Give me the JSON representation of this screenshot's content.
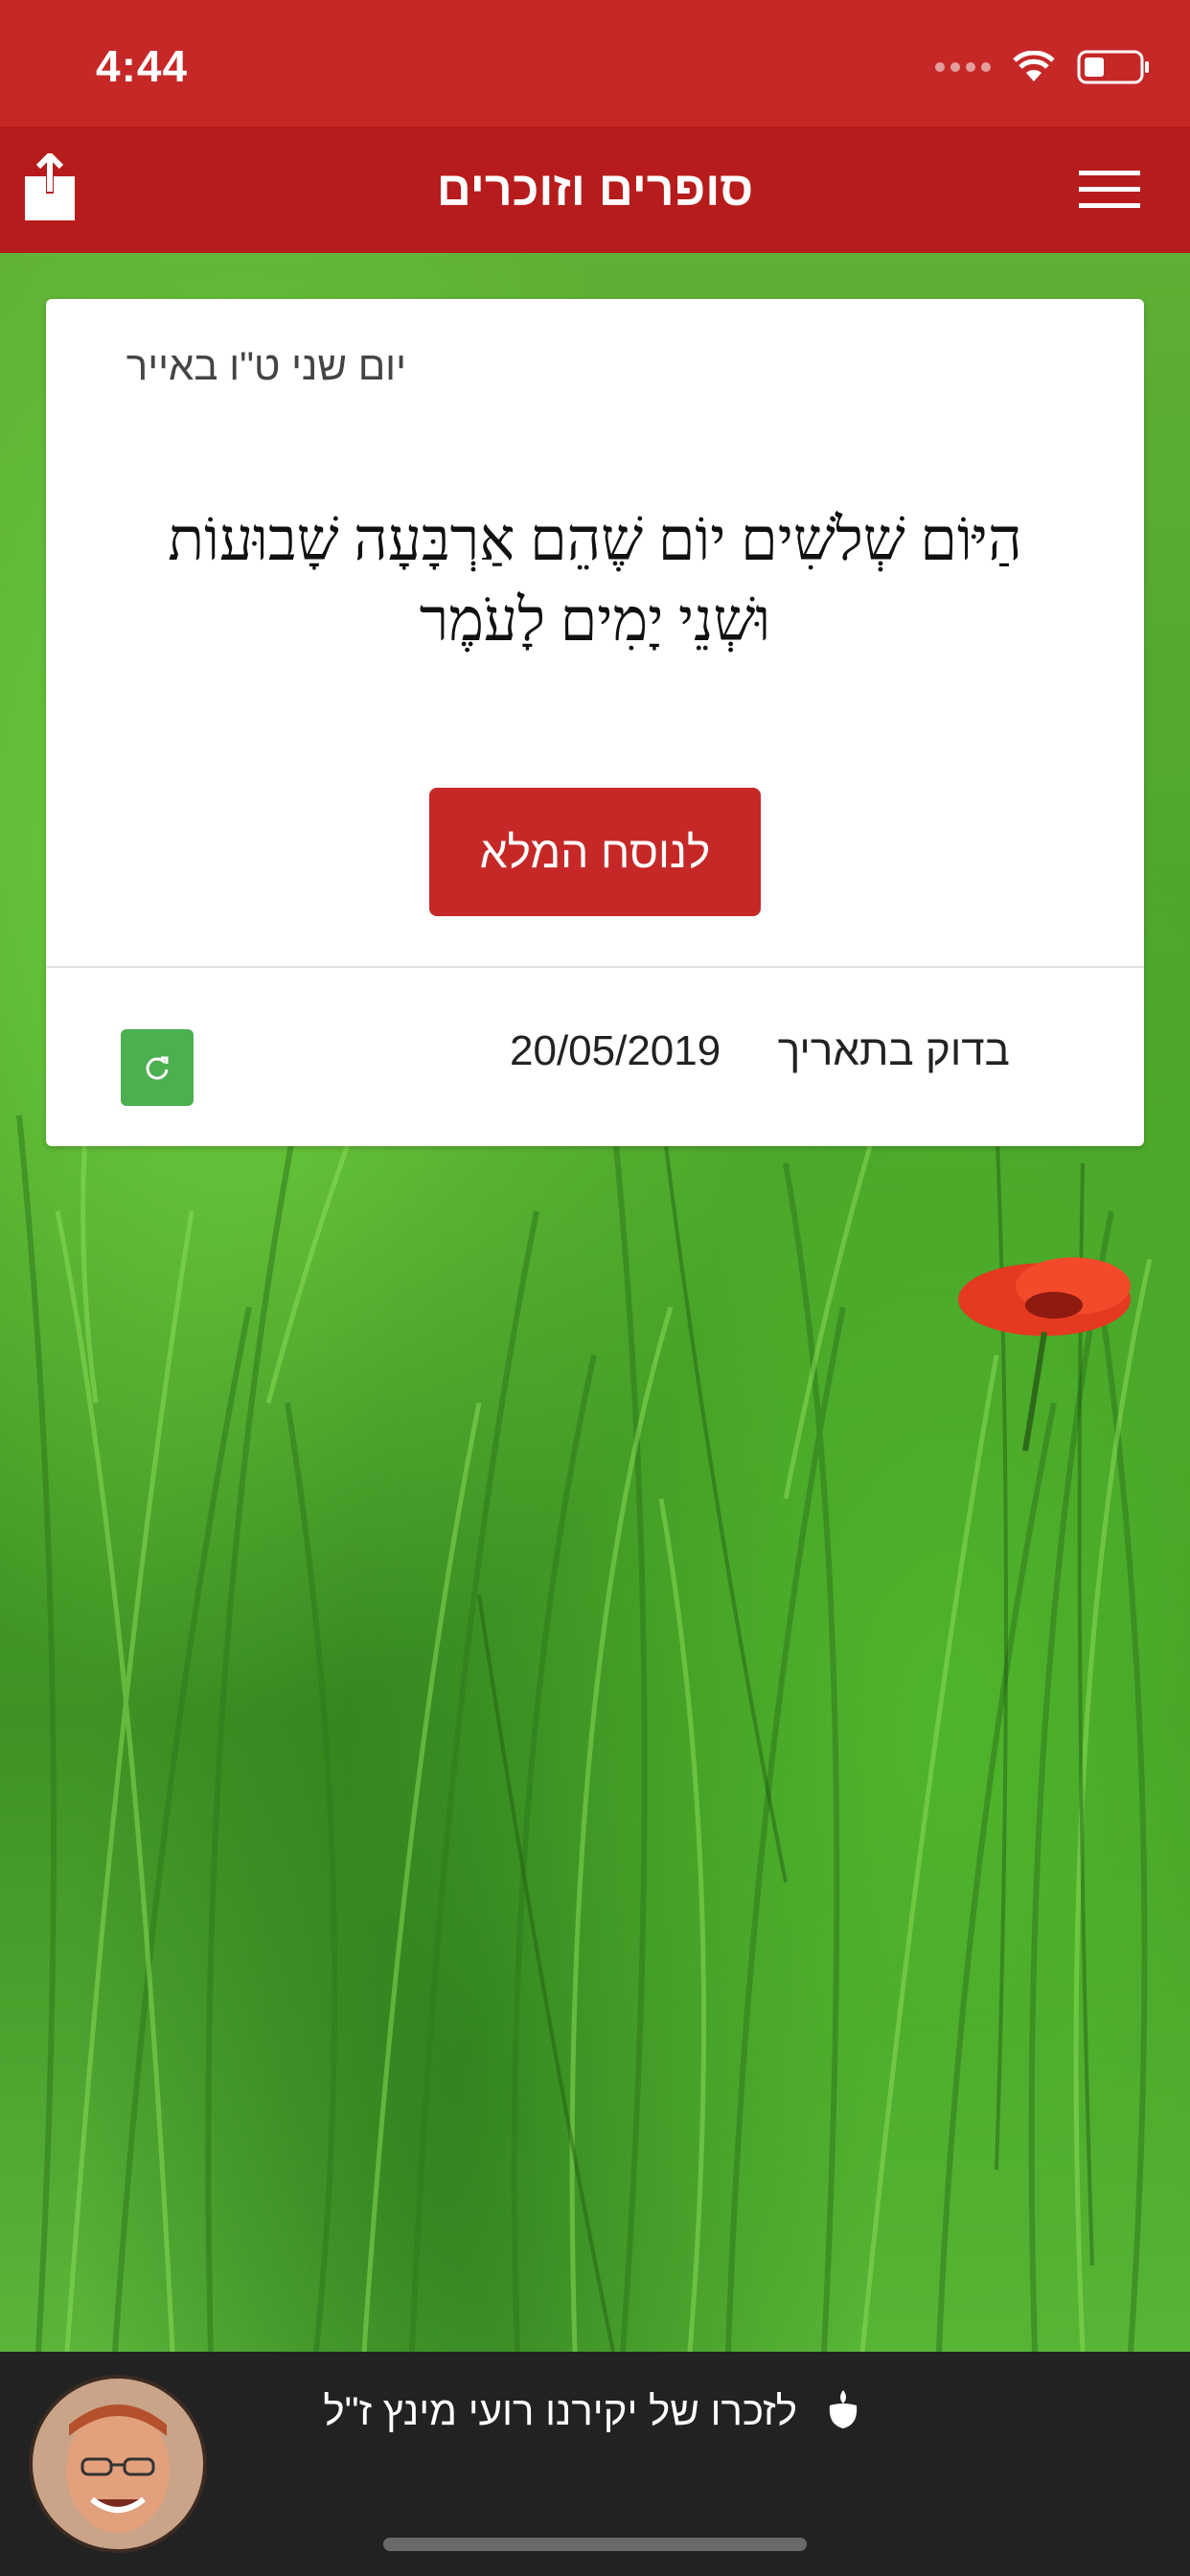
{
  "status_bar": {
    "time": "4:44"
  },
  "header": {
    "title": "סופרים וזוכרים"
  },
  "card": {
    "hebrew_date": "יום שני ט\"ו באייר",
    "omer_count": "הַיּוֹם שְׁלֹשִׁים יוֹם שֶׁהֵם אַרְבָּעָה שָׁבוּעוֹת וּשְׁנֵי יָמִים לָעֹמֶר",
    "full_text_button": "לנוסח המלא",
    "check_label": "בדוק בתאריך",
    "check_date": "20/05/2019"
  },
  "memorial": {
    "text": "לזכרו של יקירנו רועי מינץ ז\"ל"
  },
  "colors": {
    "header_red": "#b71c1c",
    "status_red": "#c62828",
    "button_red": "#c62828",
    "refresh_green": "#4caf50",
    "bottom_bar": "#222222"
  },
  "icons": [
    "share-icon",
    "menu-icon",
    "refresh-icon",
    "candle-icon",
    "wifi-icon",
    "battery-icon"
  ]
}
